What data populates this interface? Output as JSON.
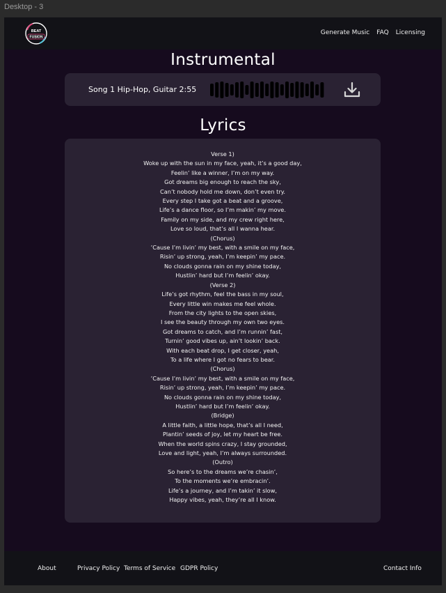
{
  "window": {
    "frame_label": "Desktop - 3"
  },
  "header": {
    "logo_text_top": "BEAT",
    "logo_text_bottom": "FUSION",
    "nav": [
      "Generate Music",
      "FAQ",
      "Licensing"
    ]
  },
  "instrumental": {
    "heading": "Instrumental",
    "track_title": "Song 1 Hip-Hop, Guitar 2:55",
    "waveform_icon": "waveform-icon",
    "download_icon": "download-icon"
  },
  "lyrics": {
    "heading": "Lyrics",
    "lines": [
      "Verse 1)",
      "Woke up with the sun in my face, yeah, it’s a good day,",
      "Feelin’ like a winner, I’m on my way.",
      "Got dreams big enough to reach the sky,",
      "Can’t nobody hold me down, don’t even try.",
      "Every step I take got a beat and a groove,",
      "Life’s a dance floor, so I’m makin’ my move.",
      "Family on my side, and my crew right here,",
      "Love so loud, that’s all I wanna hear.",
      "(Chorus)",
      "’Cause I’m livin’ my best, with a smile on my face,",
      "Risin’ up strong, yeah, I’m keepin’ my pace.",
      "No clouds gonna rain on my shine today,",
      "Hustlin’ hard but I’m feelin’ okay.",
      "(Verse 2)",
      "Life’s got rhythm, feel the bass in my soul,",
      "Every little win makes me feel whole.",
      "From the city lights to the open skies,",
      "I see the beauty through my own two eyes.",
      "Got dreams to catch, and I’m runnin’ fast,",
      "Turnin’ good vibes up, ain’t lookin’ back.",
      "With each beat drop, I get closer, yeah,",
      "To a life where I got no fears to bear.",
      "(Chorus)",
      "’Cause I’m livin’ my best, with a smile on my face,",
      "Risin’ up strong, yeah, I’m keepin’ my pace.",
      "No clouds gonna rain on my shine today,",
      "Hustlin’ hard but I’m feelin’ okay.",
      "(Bridge)",
      "A little faith, a little hope, that’s all I need,",
      "Plantin’ seeds of joy, let my heart be free.",
      "When the world spins crazy, I stay grounded,",
      "Love and light, yeah, I’m always surrounded.",
      "(Outro)",
      "So here’s to the dreams we’re chasin’,",
      "To the moments we’re embracin’.",
      "Life’s a journey, and I’m takin’ it slow,",
      "Happy vibes, yeah, they’re all I know."
    ]
  },
  "footer": {
    "about": "About",
    "privacy": "Privacy Policy",
    "terms": "Terms of Service",
    "gdpr": "GDPR Policy",
    "contact": "Contact Info"
  },
  "colors": {
    "background": "#160b1e",
    "panel": "#2a2233",
    "bar": "#121217",
    "logo_pink": "#e0457b",
    "logo_cyan": "#4fc3d9"
  }
}
